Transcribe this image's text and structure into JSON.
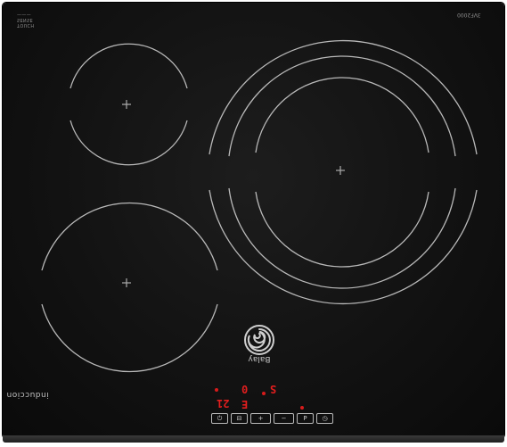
{
  "appliance": {
    "brand_label": "Balay",
    "type_label": "induccion",
    "model_label": "3VF2000",
    "top_left_marks": [
      "TOUCH",
      "SENSE",
      "———"
    ]
  },
  "displays": {
    "zone_left": "21",
    "zone_right": "S",
    "middle_top": "0",
    "middle_bottom": "E"
  },
  "controls": [
    {
      "name": "power-button",
      "label": "⏻"
    },
    {
      "name": "lock-button",
      "label": "⊟"
    },
    {
      "name": "plus-button",
      "label": "+"
    },
    {
      "name": "minus-button",
      "label": "−"
    },
    {
      "name": "boost-button",
      "label": "P"
    },
    {
      "name": "timer-button",
      "label": "◷"
    }
  ],
  "colors": {
    "glass": "#121212",
    "ring": "#b9b9b9",
    "display_red": "#e31e1e"
  }
}
